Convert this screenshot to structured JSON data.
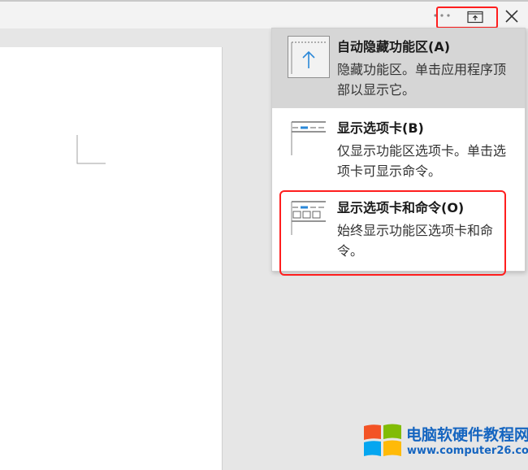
{
  "titlebar": {
    "more_icon": "ellipsis-icon",
    "ribbon_display_icon": "ribbon-display-options-icon",
    "close_icon": "close-icon"
  },
  "ribbon_menu": {
    "items": [
      {
        "title": "自动隐藏功能区(A)",
        "description": "隐藏功能区。单击应用程序顶部以显示它。",
        "icon": "auto-hide-ribbon-icon",
        "hovered": true
      },
      {
        "title": "显示选项卡(B)",
        "description": "仅显示功能区选项卡。单击选项卡可显示命令。",
        "icon": "show-tabs-icon",
        "hovered": false
      },
      {
        "title": "显示选项卡和命令(O)",
        "description": "始终显示功能区选项卡和命令。",
        "icon": "show-tabs-and-commands-icon",
        "hovered": false
      }
    ]
  },
  "watermark": {
    "title": "电脑软硬件教程网",
    "url": "www.computer26.com"
  },
  "colors": {
    "highlight_red": "#ff1e1e",
    "accent_blue": "#2b88d8",
    "hover_gray": "#d6d6d6",
    "watermark_blue": "#1565c0",
    "logo_red": "#f35325",
    "logo_green": "#81bc06",
    "logo_blue": "#05a6f0",
    "logo_yellow": "#ffba08"
  }
}
